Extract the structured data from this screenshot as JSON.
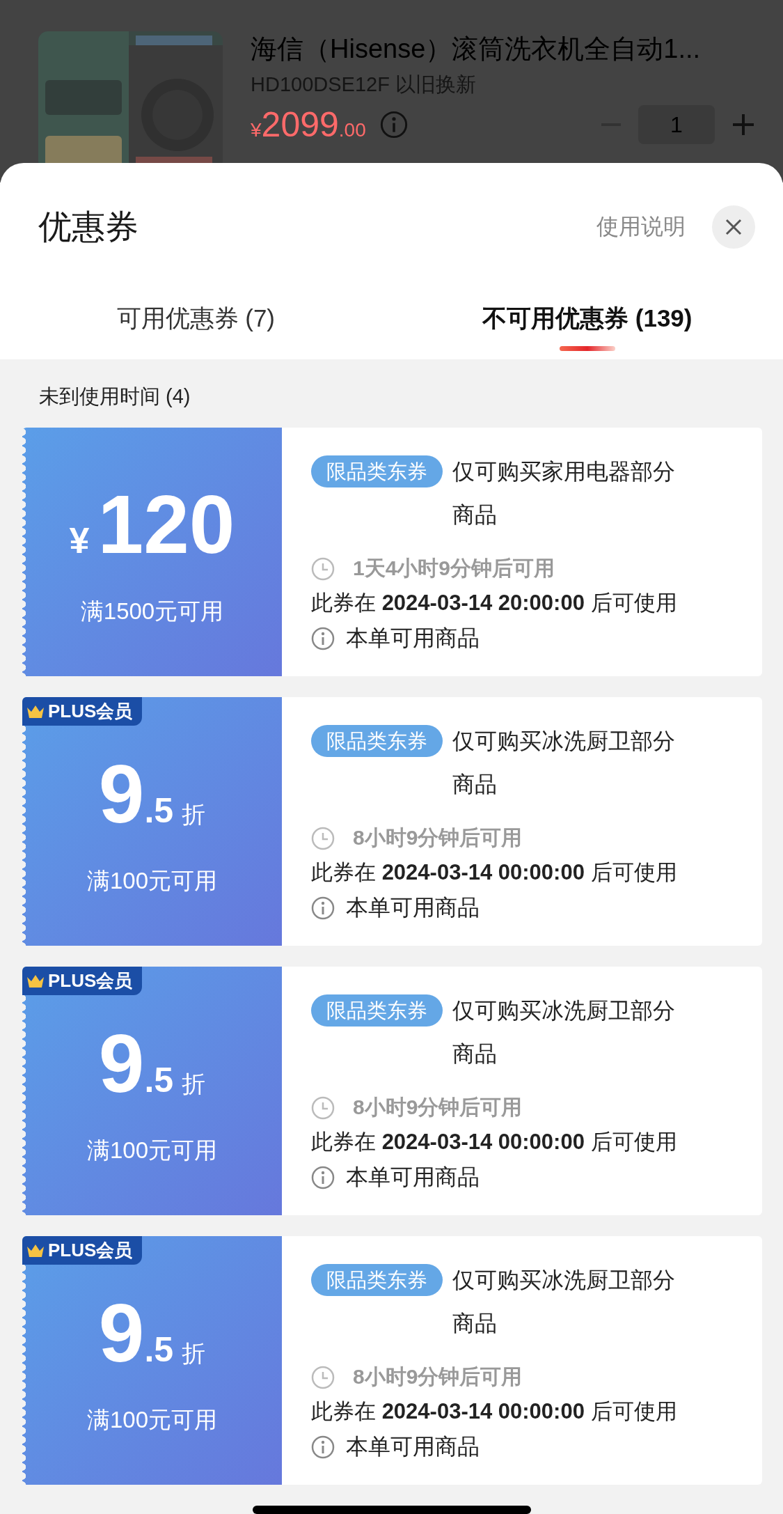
{
  "product": {
    "title": "海信（Hisense）滚筒洗衣机全自动1...",
    "subtitle": "HD100DSE12F 以旧换新",
    "currency": "¥",
    "price": "2099",
    "cents": ".00",
    "quantity": "1"
  },
  "sheet": {
    "title": "优惠券",
    "help_link": "使用说明"
  },
  "tabs": [
    {
      "label": "可用优惠券 (7)",
      "selected": false
    },
    {
      "label": "不可用优惠券 (139)",
      "selected": true
    }
  ],
  "section_label": "未到使用时间 (4)",
  "coupons": [
    {
      "kind": "money",
      "currency": "¥",
      "amount": "120",
      "condition": "满1500元可用",
      "tag": "限品类东券",
      "description": "仅可购买家用电器部分商品",
      "countdown": "1天4小时9分钟后可用",
      "available_from": "此券在 **2024-03-14 20:00:00** 后可使用",
      "applicable": "本单可用商品"
    },
    {
      "kind": "discount",
      "badge": "PLUS会员",
      "amount": "9",
      "decimal": ".5",
      "unit": "折",
      "condition": "满100元可用",
      "tag": "限品类东券",
      "description": "仅可购买冰洗厨卫部分商品",
      "countdown": "8小时9分钟后可用",
      "available_from": "此券在 **2024-03-14 00:00:00** 后可使用",
      "applicable": "本单可用商品"
    },
    {
      "kind": "discount",
      "badge": "PLUS会员",
      "amount": "9",
      "decimal": ".5",
      "unit": "折",
      "condition": "满100元可用",
      "tag": "限品类东券",
      "description": "仅可购买冰洗厨卫部分商品",
      "countdown": "8小时9分钟后可用",
      "available_from": "此券在 **2024-03-14 00:00:00** 后可使用",
      "applicable": "本单可用商品"
    },
    {
      "kind": "discount",
      "badge": "PLUS会员",
      "amount": "9",
      "decimal": ".5",
      "unit": "折",
      "condition": "满100元可用",
      "tag": "限品类东券",
      "description": "仅可购买冰洗厨卫部分商品",
      "countdown": "8小时9分钟后可用",
      "available_from": "此券在 **2024-03-14 00:00:00** 后可使用",
      "applicable": "本单可用商品"
    }
  ]
}
